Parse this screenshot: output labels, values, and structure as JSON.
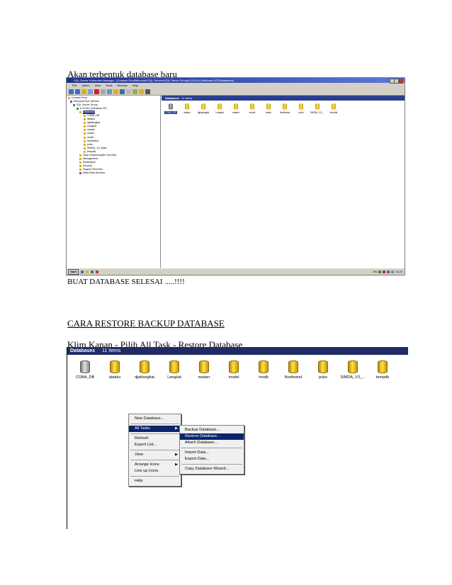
{
  "doc": {
    "line1": "Akan terbentuk  database baru",
    "line2": "BUAT DATABASE SELESAI  .....!!!!",
    "heading": "CARA RESTORE  BACKUP DATABASE",
    "line3": "Klim  Kanan  -  Pilih  All  Task - Restore Database"
  },
  "screenshot1": {
    "window_title": "SQL Server Enterprise Manager - [Console Root\\Microsoft SQL Servers\\SQL Server Group\\(LOCAL) (Windows NT)\\Databases]",
    "menu": [
      "File",
      "Action",
      "View",
      "Tools",
      "Window",
      "Help"
    ],
    "tree": [
      "Console Root",
      "Microsoft SQL Servers",
      "SQL Server Group",
      "(LOCAL) (Windows NT)",
      "Databases",
      "COBA_DB",
      "dataku",
      "djpklangkat",
      "Langkat",
      "master",
      "model",
      "msdb",
      "Northwind",
      "pubs",
      "SIMDA_V3_Data",
      "tempdb",
      "Data Transformation Services",
      "Management",
      "Replication",
      "Security",
      "Support Services",
      "Meta Data Services"
    ],
    "header_title": "Databases",
    "header_count": "11 Items",
    "databases": [
      "COBA_DB",
      "dataku",
      "djpklangkat",
      "Langkat",
      "master",
      "model",
      "msdb",
      "Northwind",
      "pubs",
      "SIMDA_V3_...",
      "tempdb"
    ],
    "taskbar_start": "Start",
    "taskbar_lang": "EN",
    "taskbar_time": "11:23"
  },
  "screenshot2": {
    "header_title": "Databases",
    "header_count": "11 Items",
    "databases": [
      "COBA_DB",
      "dataku",
      "djpklangkat",
      "Langkat",
      "master",
      "model",
      "msdb",
      "Northwind",
      "pubs",
      "SIMDA_V3_...",
      "tempdb"
    ],
    "context_menu": {
      "new_database": "New Database...",
      "all_tasks": "All Tasks",
      "refresh": "Refresh",
      "export_list": "Export List...",
      "view": "View",
      "arrange_icons": "Arrange Icons",
      "line_up_icons": "Line up Icons",
      "help": "Help"
    },
    "submenu": {
      "backup": "Backup Database...",
      "restore": "Restore Database...",
      "attach": "Attach Database...",
      "import": "Import Data...",
      "export": "Export Data...",
      "copy_wizard": "Copy Database Wizard..."
    }
  }
}
